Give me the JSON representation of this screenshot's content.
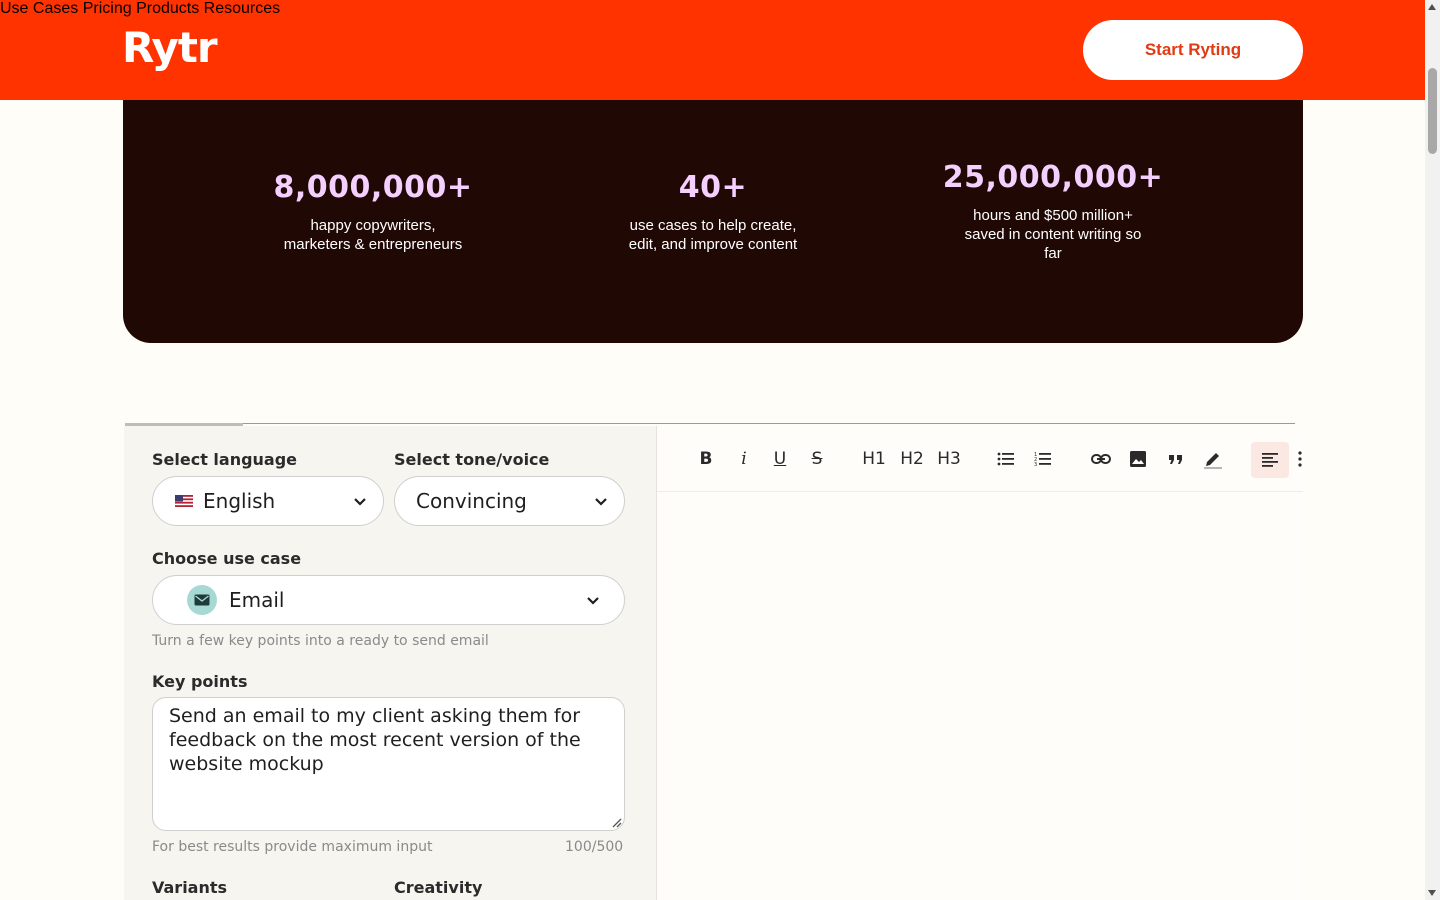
{
  "header": {
    "logo": "Rytr",
    "nav": [
      "Use Cases",
      "Pricing",
      "Products",
      "Resources"
    ],
    "cta": "Start Ryting"
  },
  "stats": [
    {
      "number": "8,000,000+",
      "desc_line1": "happy copywriters,",
      "desc_line2": "marketers & entrepreneurs"
    },
    {
      "number": "40+",
      "desc_line1": "use cases to help create,",
      "desc_line2": "edit, and improve content"
    },
    {
      "number": "25,000,000+",
      "desc_line1": "hours and $500 million+",
      "desc_line2": "saved in content writing so",
      "desc_line3": "far"
    }
  ],
  "form": {
    "language_label": "Select language",
    "language_value": "English",
    "tone_label": "Select tone/voice",
    "tone_value": "Convincing",
    "usecase_label": "Choose use case",
    "usecase_value": "Email",
    "usecase_helper": "Turn a few key points into a ready to send email",
    "keypoints_label": "Key points",
    "keypoints_value": "Send an email to my client asking them for feedback on the most recent version of the website mockup",
    "keypoints_helper": "For best results provide maximum input",
    "keypoints_count": "100/500",
    "variants_label": "Variants",
    "creativity_label": "Creativity"
  },
  "toolbar": {
    "bold": "B",
    "italic": "i",
    "underline": "U",
    "strike": "S",
    "h1": "H1",
    "h2": "H2",
    "h3": "H3",
    "icons": [
      "bullet-list-icon",
      "numbered-list-icon",
      "link-icon",
      "image-icon",
      "quote-icon",
      "highlight-icon",
      "align-left-icon",
      "more-icon"
    ]
  },
  "colors": {
    "brand": "#ff3300",
    "stats_bg": "#200805",
    "stat_number": "#f4d0ff"
  }
}
